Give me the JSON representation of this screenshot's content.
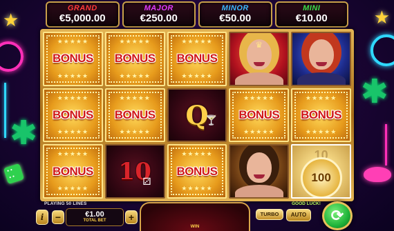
{
  "jackpots": [
    {
      "name": "GRAND",
      "value": "€5,000.00",
      "color": "#ff3a3a"
    },
    {
      "name": "MAJOR",
      "value": "€250.00",
      "color": "#e23bff"
    },
    {
      "name": "MINOR",
      "value": "€50.00",
      "color": "#3ab8ff"
    },
    {
      "name": "MINI",
      "value": "€10.00",
      "color": "#39e04a"
    }
  ],
  "reels": {
    "bonus_label": "BONUS",
    "queen_symbol": "Q",
    "ten_symbol": "10",
    "coin_value": "100",
    "coin_ghost_value": "10",
    "martini_icon": "martini-glass-icon",
    "dice_icon": "dice-icon",
    "crown_icon": "crown-icon"
  },
  "controls": {
    "lines_text": "PLAYING 50 LINES",
    "good_luck_text": "GOOD LUCK!",
    "info_label": "i",
    "minus_label": "−",
    "plus_label": "+",
    "bet_value": "€1.00",
    "bet_label": "TOTAL BET",
    "win_label": "WIN",
    "turbo_label": "TURBO",
    "auto_label": "AUTO",
    "spin_icon": "spin-arrows-icon"
  }
}
